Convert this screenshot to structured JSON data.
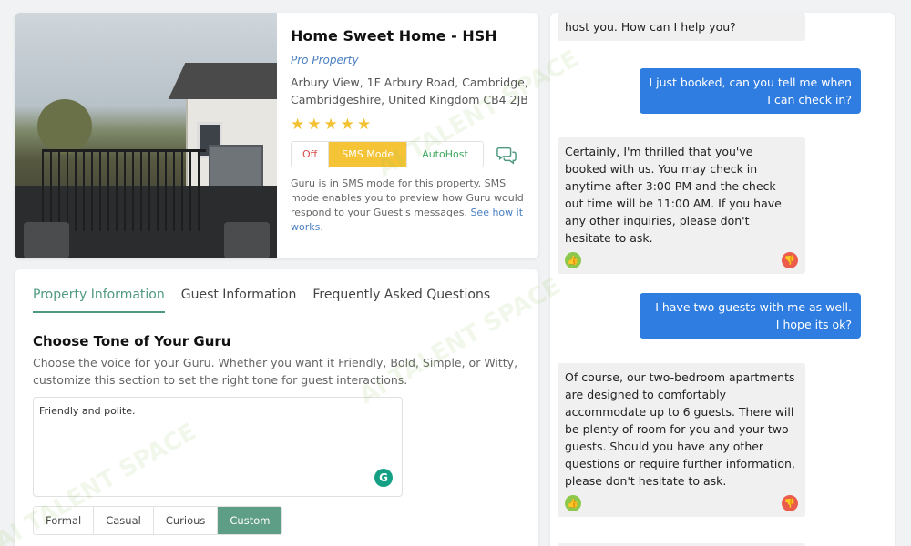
{
  "property": {
    "title": "Home Sweet Home - HSH",
    "subtitle": "Pro Property",
    "address": "Arbury View, 1F Arbury Road, Cambridge, Cambridgeshire, United Kingdom CB4 2JB",
    "rating": 5,
    "stars": [
      "★",
      "★",
      "★",
      "★",
      "★"
    ],
    "modes": {
      "off": "Off",
      "sms": "SMS Mode",
      "autohost": "AutoHost"
    },
    "active_mode": "sms",
    "mode_description": "Guru is in SMS mode for this property. SMS mode enables you to preview how Guru would respond to your Guest's messages.",
    "mode_link": "See how it works."
  },
  "settings": {
    "tabs": [
      {
        "label": "Property Information"
      },
      {
        "label": "Guest Information"
      },
      {
        "label": "Frequently Asked Questions"
      }
    ],
    "active_tab": 0,
    "section_title": "Choose Tone of Your Guru",
    "section_desc": "Choose the voice for your Guru. Whether you want it Friendly, Bold, Simple, or Witty, customize this section to set the right tone for guest interactions.",
    "tone_value": "Friendly and polite.",
    "grammar_icon": "G",
    "tones": [
      {
        "label": "Formal"
      },
      {
        "label": "Casual"
      },
      {
        "label": "Curious"
      },
      {
        "label": "Custom"
      }
    ],
    "active_tone": "Custom"
  },
  "chat": {
    "messages": [
      {
        "from": "guru",
        "text": "host you. How can I help you?"
      },
      {
        "from": "guest",
        "text": "I just booked, can you tell me when I can check in?"
      },
      {
        "from": "guru",
        "text": "Certainly, I'm thrilled that you've booked with us. You may check in anytime after 3:00 PM and the check-out time will be 11:00 AM. If you have any other inquiries, please don't hesitate to ask."
      },
      {
        "from": "guest",
        "text": "I have two guests with me as well. I hope its ok?"
      },
      {
        "from": "guru",
        "text": "Of course, our two-bedroom apartments are designed to comfortably accommodate up to 6 guests. There will be plenty of room for you and your two guests. Should you have any other questions or require further information, please don't hesitate to ask."
      }
    ],
    "thumbs_up_icon": "👍",
    "thumbs_down_icon": "👎"
  },
  "watermark": "AI TALENT SPACE",
  "colors": {
    "accent_green": "#4f9a7f",
    "sms_yellow": "#f5c336",
    "guest_bubble": "#2f7de1",
    "off_red": "#d54b4b",
    "autohost_green": "#3fa65e",
    "link_blue": "#4a7fc1",
    "star": "#f2c232"
  }
}
